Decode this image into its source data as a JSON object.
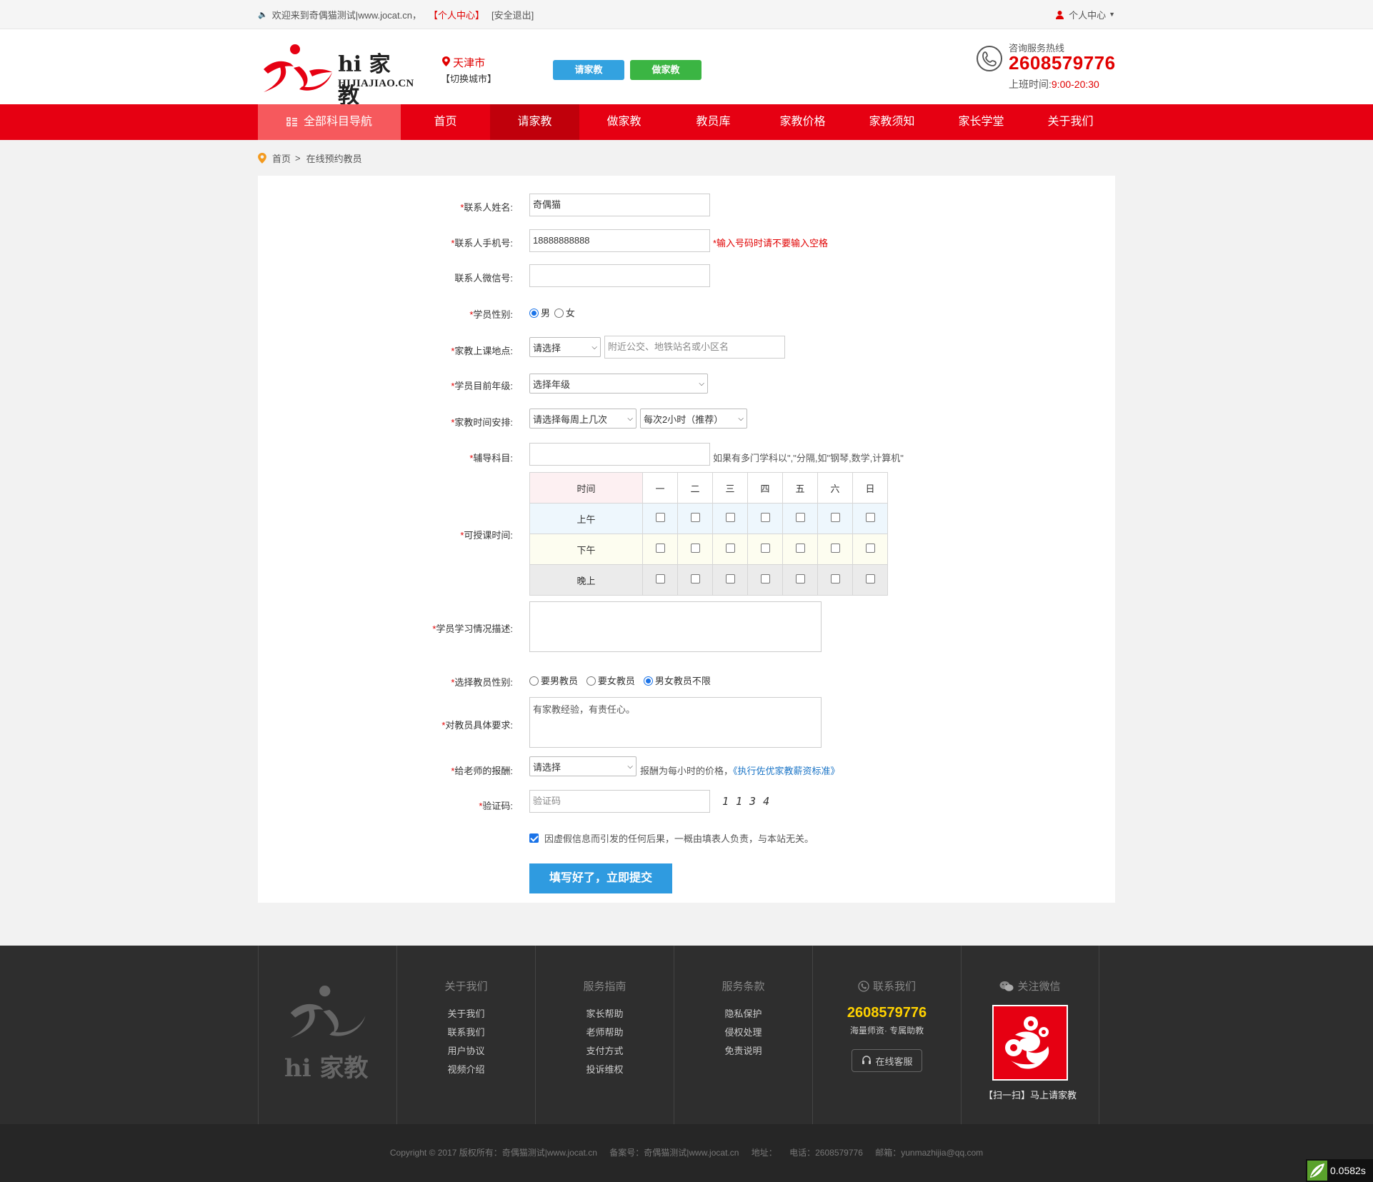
{
  "topbar": {
    "welcome": "欢迎来到奇偶猫测试|www.jocat.cn，",
    "personal_center_link": "【个人中心】",
    "logout_link": "[安全退出]",
    "user_menu": "个人中心"
  },
  "header": {
    "logo_text": "hi 家教",
    "logo_domain": "HIJIAJIAO.CN",
    "city": "天津市",
    "switch_city": "【切换城市】",
    "btn_hire": "请家教",
    "btn_teach": "做家教",
    "hotline_label": "咨询服务热线",
    "hotline_number": "2608579776",
    "hours_label": "上班时间:",
    "hours_value": "9:00-20:30"
  },
  "nav": {
    "all_subjects": "全部科目导航",
    "items": [
      "首页",
      "请家教",
      "做家教",
      "教员库",
      "家教价格",
      "家教须知",
      "家长学堂",
      "关于我们"
    ],
    "active_index": 1
  },
  "breadcrumb": {
    "home": "首页",
    "sep": ">",
    "current": "在线预约教员"
  },
  "form": {
    "name_label": "联系人姓名:",
    "name_value": "奇偶猫",
    "phone_label": "联系人手机号:",
    "phone_value": "18888888888",
    "phone_hint": "*输入号码时请不要输入空格",
    "wechat_label": "联系人微信号:",
    "wechat_value": "",
    "gender_label": "学员性别:",
    "gender_options": [
      "男",
      "女"
    ],
    "gender_selected": "男",
    "location_label": "家教上课地点:",
    "location_select": "请选择",
    "location_placeholder": "附近公交、地铁站名或小区名",
    "grade_label": "学员目前年级:",
    "grade_select": "选择年级",
    "time_label": "家教时间安排:",
    "times_per_week": "请选择每周上几次",
    "hours_per_session": "每次2小时（推荐）",
    "subject_label": "辅导科目:",
    "subject_value": "",
    "subject_hint": "如果有多门学科以\",\"分隔,如\"钢琴,数学,计算机\"",
    "schedule_label": "可授课时间:",
    "schedule": {
      "header_time": "时间",
      "days": [
        "一",
        "二",
        "三",
        "四",
        "五",
        "六",
        "日"
      ],
      "periods": [
        "上午",
        "下午",
        "晚上"
      ]
    },
    "desc_label": "学员学习情况描述:",
    "desc_value": "",
    "tgender_label": "选择教员性别:",
    "tgender_options": [
      "要男教员",
      "要女教员",
      "男女教员不限"
    ],
    "tgender_selected": "男女教员不限",
    "req_label": "对教员具体要求:",
    "req_value": "有家教经验，有责任心。",
    "pay_label": "给老师的报酬:",
    "pay_select": "请选择",
    "pay_hint": "报酬为每小时的价格，",
    "pay_link": "《执行佐优家教薪资标准》",
    "captcha_label": "验证码:",
    "captcha_placeholder": "验证码",
    "captcha_code": "1134",
    "agree_text": "因虚假信息而引发的任何后果，一概由填表人负责，与本站无关。",
    "submit": "填写好了，立即提交",
    "required_mark": "*"
  },
  "footer": {
    "logo_text": "hi 家教",
    "about_title": "关于我们",
    "about_items": [
      "关于我们",
      "联系我们",
      "用户协议",
      "视频介绍"
    ],
    "guide_title": "服务指南",
    "guide_items": [
      "家长帮助",
      "老师帮助",
      "支付方式",
      "投诉维权"
    ],
    "terms_title": "服务条款",
    "terms_items": [
      "隐私保护",
      "侵权处理",
      "免责说明"
    ],
    "contact_title": "联系我们",
    "contact_number": "2608579776",
    "contact_slogan": "海量师资· 专属助教",
    "online_service": "在线客服",
    "wechat_title": "关注微信",
    "wechat_caption": "【扫一扫】马上请家教"
  },
  "copyright": {
    "text": "Copyright © 2017 版权所有：奇偶猫测试|www.jocat.cn",
    "icp": "备案号：奇偶猫测试|www.jocat.cn",
    "address": "地址：",
    "phone": "电话：2608579776",
    "email": "邮箱：yunmazhijia@qq.com"
  },
  "timer": "0.0582s",
  "colors": {
    "brand_red": "#e60012",
    "nav_active": "#c0000b",
    "blue": "#33a2e0",
    "green": "#3bb543"
  }
}
